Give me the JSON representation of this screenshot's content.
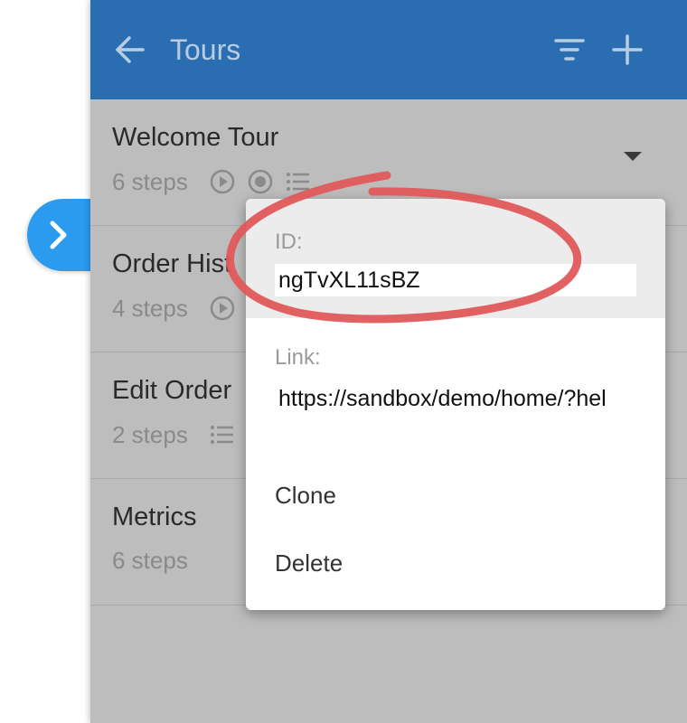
{
  "header": {
    "title": "Tours",
    "back_icon": "arrow-left-icon",
    "filter_icon": "filter-icon",
    "add_icon": "plus-icon"
  },
  "side_toggle": {
    "icon": "chevron-right-icon",
    "color": "#2b9bf0"
  },
  "tours": [
    {
      "name": "Welcome Tour",
      "steps": "6 steps",
      "icons": [
        "play-circle-icon",
        "record-icon",
        "list-icon"
      ]
    },
    {
      "name": "Order Hist",
      "steps": "4 steps",
      "icons": [
        "play-circle-icon"
      ]
    },
    {
      "name": "Edit Order",
      "steps": "2 steps",
      "icons": [
        "list-icon"
      ]
    },
    {
      "name": "Metrics",
      "steps": "6 steps",
      "icons": []
    }
  ],
  "menu": {
    "id_label": "ID:",
    "id_value": "ngTvXL11sBZ",
    "link_label": "Link:",
    "link_value": "https://sandbox/demo/home/?hel",
    "clone_label": "Clone",
    "delete_label": "Delete"
  },
  "colors": {
    "header_bg": "#2a6db0",
    "panel_bg": "#bdbdbd",
    "annotation_red": "#e0585a"
  }
}
